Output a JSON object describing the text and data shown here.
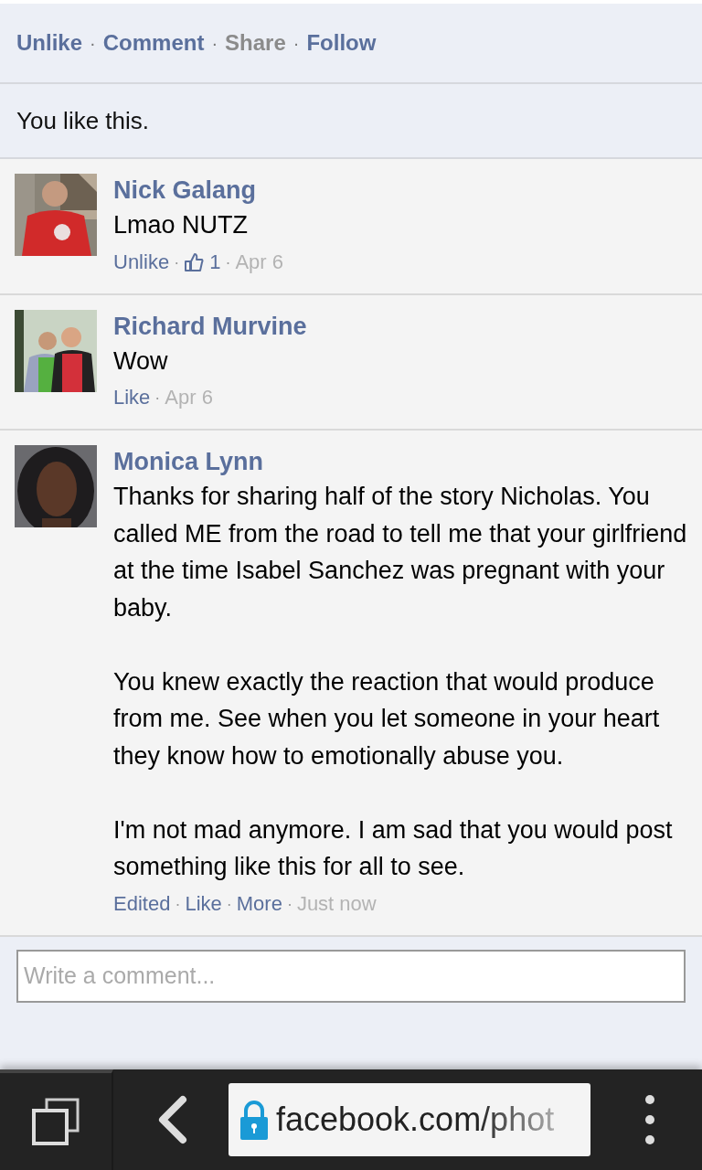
{
  "post_actions": [
    {
      "label": "Unlike",
      "disabled": false
    },
    {
      "label": "Comment",
      "disabled": false
    },
    {
      "label": "Share",
      "disabled": true
    },
    {
      "label": "Follow",
      "disabled": false
    }
  ],
  "action_separator": "·",
  "likes_summary": "You like this.",
  "comments": [
    {
      "name": "Nick Galang",
      "paragraphs": [
        "Lmao NUTZ"
      ],
      "meta": [
        {
          "kind": "link",
          "text": "Unlike"
        },
        {
          "kind": "dot",
          "text": "·"
        },
        {
          "kind": "likes",
          "text": "1"
        },
        {
          "kind": "dot",
          "text": "·"
        },
        {
          "kind": "time",
          "text": "Apr 6"
        }
      ]
    },
    {
      "name": "Richard Murvine",
      "paragraphs": [
        "Wow"
      ],
      "meta": [
        {
          "kind": "link",
          "text": "Like"
        },
        {
          "kind": "dot",
          "text": "·"
        },
        {
          "kind": "time",
          "text": "Apr 6"
        }
      ]
    },
    {
      "name": "Monica Lynn",
      "paragraphs": [
        "Thanks for sharing half of the story Nicholas. You called ME from the road to tell me that your girlfriend at the time Isabel Sanchez was pregnant with your baby.",
        "You knew exactly the reaction that would produce from me. See when you let someone in your heart they know how to emotionally abuse you.",
        "I'm not mad anymore. I am sad that you would post something like this for all to see."
      ],
      "meta": [
        {
          "kind": "link",
          "text": "Edited"
        },
        {
          "kind": "dot",
          "text": "·"
        },
        {
          "kind": "link",
          "text": "Like"
        },
        {
          "kind": "dot",
          "text": "·"
        },
        {
          "kind": "link",
          "text": "More"
        },
        {
          "kind": "dot",
          "text": "·"
        },
        {
          "kind": "time",
          "text": "Just now"
        }
      ]
    }
  ],
  "comment_field": {
    "placeholder": "Write a comment..."
  },
  "browser_bar": {
    "url": "facebook.com/phot"
  }
}
